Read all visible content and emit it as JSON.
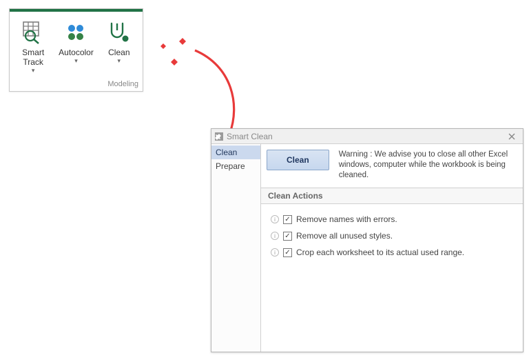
{
  "ribbon": {
    "group_label": "Modeling",
    "buttons": [
      {
        "label": "Smart\nTrack"
      },
      {
        "label": "Autocolor"
      },
      {
        "label": "Clean"
      }
    ]
  },
  "dialog": {
    "title": "Smart Clean",
    "side": [
      {
        "label": "Clean",
        "selected": true
      },
      {
        "label": "Prepare",
        "selected": false
      }
    ],
    "clean_button": "Clean",
    "warning": "Warning : We advise you to close all other Excel windows, computer while the workbook is being cleaned.",
    "section_header": "Clean Actions",
    "actions": [
      {
        "label": "Remove names with errors.",
        "checked": true
      },
      {
        "label": "Remove all unused styles.",
        "checked": true
      },
      {
        "label": "Crop each worksheet to its actual used range.",
        "checked": true
      }
    ]
  }
}
